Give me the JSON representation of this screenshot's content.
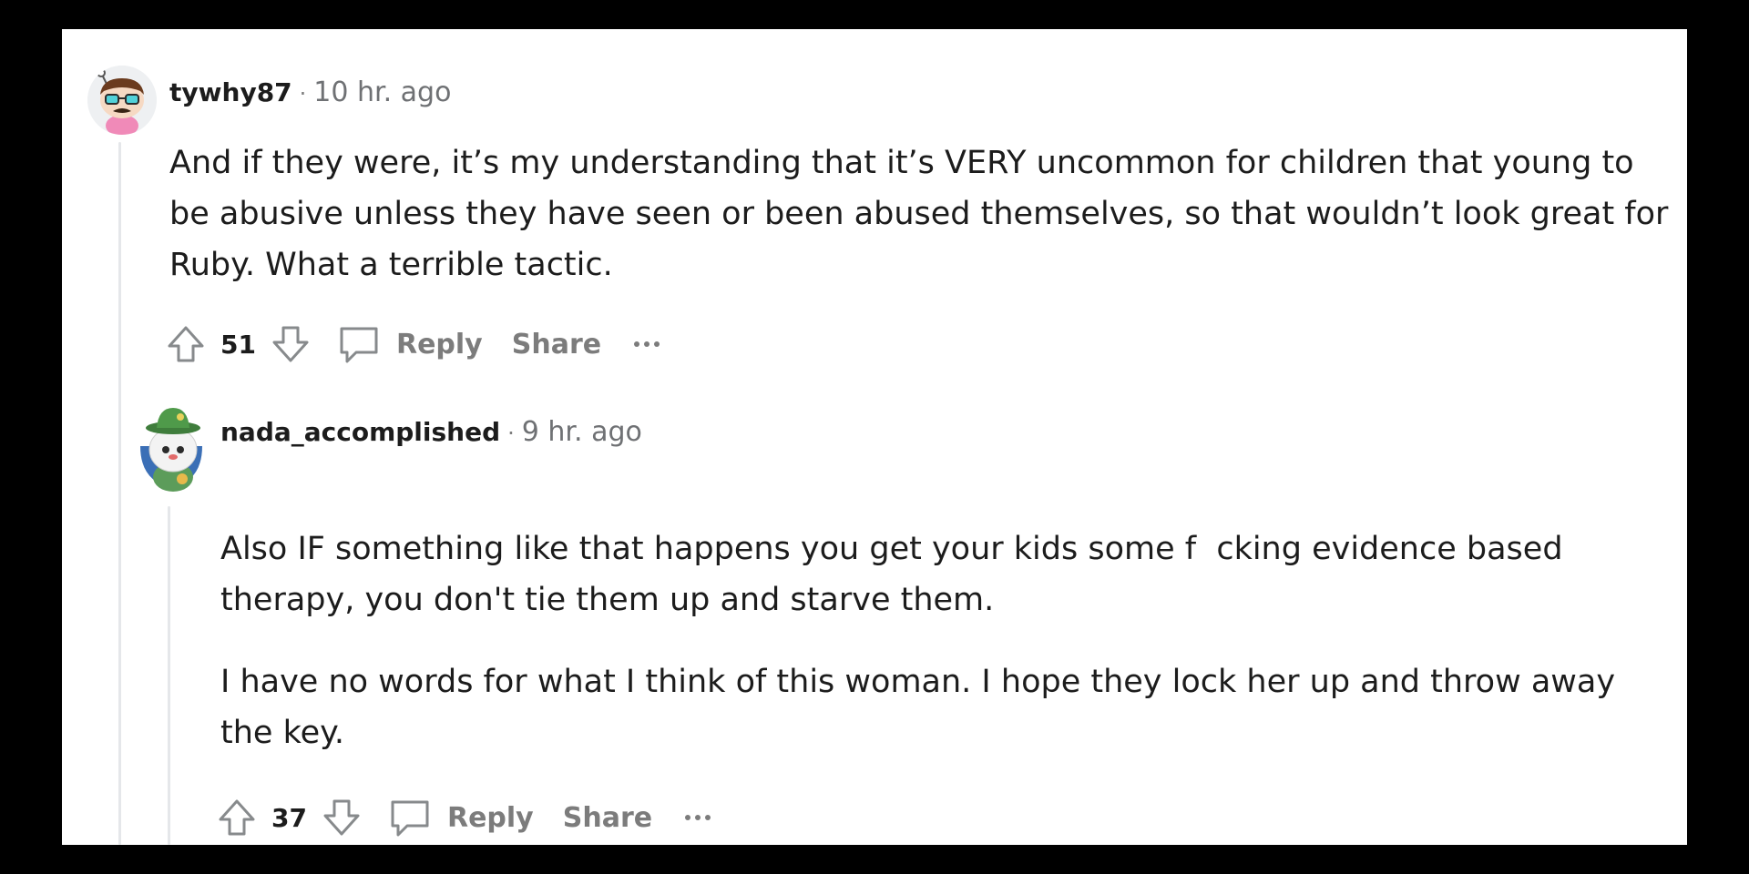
{
  "comments": [
    {
      "username": "tywhy87",
      "separator": "·",
      "time": "10 hr. ago",
      "body": "And if they were, it’s my understanding that it’s VERY uncommon for children that young to be abusive unless they have seen or been abused themselves, so that wouldn’t look great for Ruby. What a terrible tactic.",
      "votes": "51",
      "reply_label": "Reply",
      "share_label": "Share",
      "avatar_icon": "snoo-avatar-glasses-icon"
    },
    {
      "username": "nada_accomplished",
      "separator": "·",
      "time": "9 hr. ago",
      "paragraphs": [
        "Also IF something like that happens you get your kids some f  cking evidence based therapy, you don't tie them up and starve them.",
        "I have no words for what I think of this woman. I hope they lock her up and throw away the key."
      ],
      "votes": "37",
      "reply_label": "Reply",
      "share_label": "Share",
      "avatar_icon": "snoo-avatar-green-hat-icon"
    }
  ],
  "colors": {
    "background": "#000000",
    "panel": "#ffffff",
    "text": "#1c1c1c",
    "muted": "#7c7c7c",
    "thread_line": "#e5e7ea"
  }
}
